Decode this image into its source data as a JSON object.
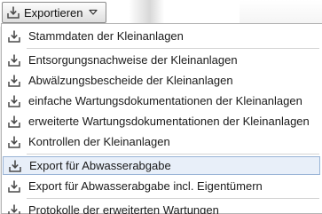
{
  "button": {
    "label": "Exportieren",
    "icon": "download-icon",
    "caret_icon": "chevron-down-icon"
  },
  "menu": {
    "groups": [
      [
        {
          "label": "Stammdaten der Kleinanlagen",
          "icon": "download-icon"
        }
      ],
      [
        {
          "label": "Entsorgungsnachweise der Kleinanlagen",
          "icon": "download-icon"
        },
        {
          "label": "Abwälzungsbescheide der Kleinanlagen",
          "icon": "download-icon"
        },
        {
          "label": "einfache Wartungsdokumentationen der Kleinanlagen",
          "icon": "download-icon"
        },
        {
          "label": "erweiterte Wartungsdokumentationen der Kleinanlagen",
          "icon": "download-icon"
        },
        {
          "label": "Kontrollen der Kleinanlagen",
          "icon": "download-icon"
        }
      ],
      [
        {
          "label": "Export für Abwasserabgabe",
          "icon": "download-icon",
          "hovered": true
        },
        {
          "label": "Export für Abwasserabgabe incl. Eigentümern",
          "icon": "download-icon"
        }
      ],
      [
        {
          "label": "Protokolle der erweiterten Wartungen",
          "icon": "download-icon"
        }
      ]
    ]
  },
  "colors": {
    "hover_background": "#e8eff9",
    "hover_border": "#99b4d6",
    "icon_color": "#4a4a4a"
  }
}
